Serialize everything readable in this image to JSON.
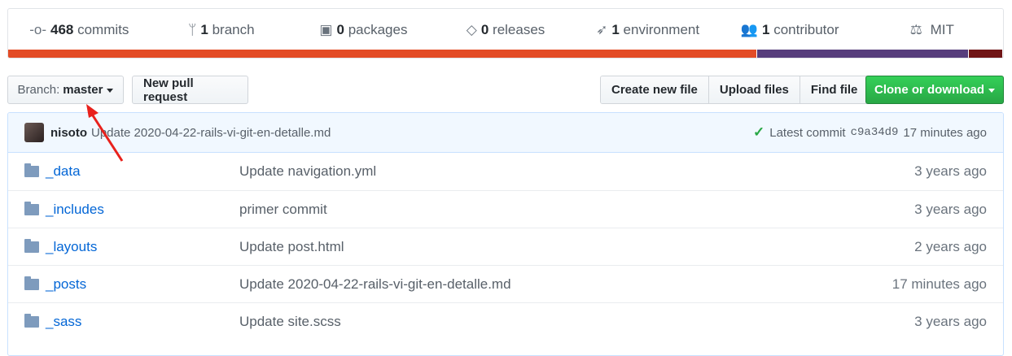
{
  "stats": [
    {
      "icon": "commit-icon",
      "glyph": "-o-",
      "count": "468",
      "label": "commits"
    },
    {
      "icon": "branch-icon",
      "glyph": "ᛘ",
      "count": "1",
      "label": "branch"
    },
    {
      "icon": "package-icon",
      "glyph": "▣",
      "count": "0",
      "label": "packages"
    },
    {
      "icon": "tag-icon",
      "glyph": "◇",
      "count": "0",
      "label": "releases"
    },
    {
      "icon": "rocket-icon",
      "glyph": "➶",
      "count": "1",
      "label": "environment"
    },
    {
      "icon": "people-icon",
      "glyph": "👥",
      "count": "1",
      "label": "contributor"
    },
    {
      "icon": "law-icon",
      "glyph": "⚖",
      "count": "",
      "label": "MIT"
    }
  ],
  "languages": [
    {
      "percent": 75.3,
      "color": "#e34c26"
    },
    {
      "percent": 21.3,
      "color": "#563d7c"
    },
    {
      "percent": 3.4,
      "color": "#701516"
    }
  ],
  "toolbar": {
    "branch_label": "Branch:",
    "branch_value": "master",
    "new_pr": "New pull request",
    "create_file": "Create new file",
    "upload_files": "Upload files",
    "find_file": "Find file",
    "clone": "Clone or download"
  },
  "commit": {
    "author": "nisoto",
    "message": "Update 2020-04-22-rails-vi-git-en-detalle.md",
    "latest_label": "Latest commit",
    "sha": "c9a34d9",
    "age": "17 minutes ago"
  },
  "files": [
    {
      "name": "_data",
      "message": "Update navigation.yml",
      "age": "3 years ago"
    },
    {
      "name": "_includes",
      "message": "primer commit",
      "age": "3 years ago"
    },
    {
      "name": "_layouts",
      "message": "Update post.html",
      "age": "2 years ago"
    },
    {
      "name": "_posts",
      "message": "Update 2020-04-22-rails-vi-git-en-detalle.md",
      "age": "17 minutes ago"
    },
    {
      "name": "_sass",
      "message": "Update site.scss",
      "age": "3 years ago"
    }
  ]
}
